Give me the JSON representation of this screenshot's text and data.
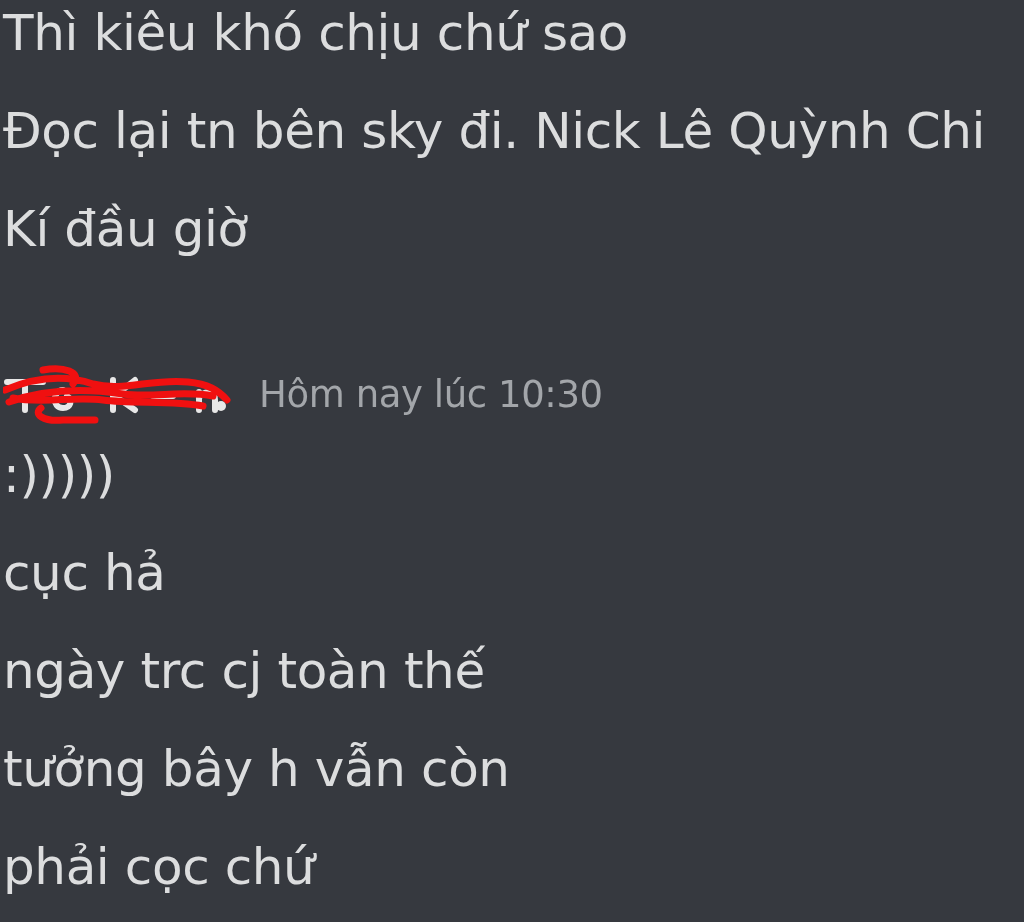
{
  "message_groups": [
    {
      "messages": [
        "Thì kiêu khó chịu chứ sao",
        "Đọc lại tn bên sky đi. Nick Lê Quỳnh Chi",
        "Kí đầu giờ"
      ]
    },
    {
      "author": {
        "redacted": true
      },
      "timestamp": "Hôm nay lúc 10:30",
      "messages": [
        ":)))))",
        "cục hả",
        "ngày trc cj toàn thế",
        "tưởng bây h vẫn còn",
        "phải cọc chứ"
      ]
    }
  ]
}
